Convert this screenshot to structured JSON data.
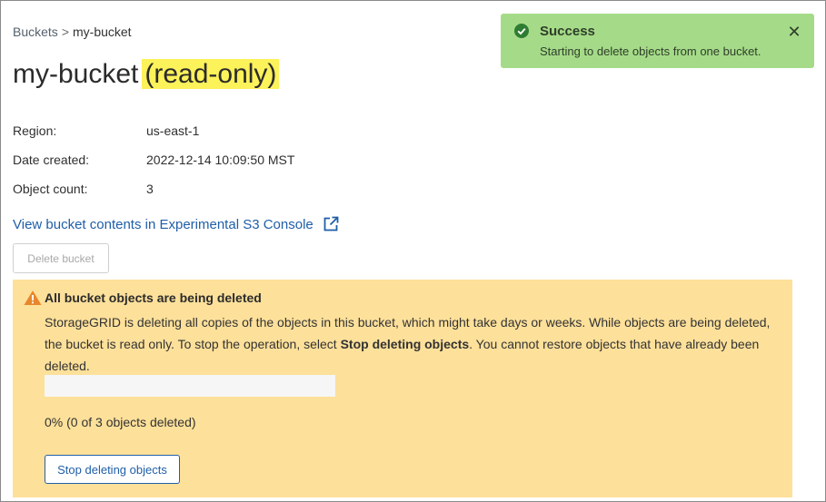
{
  "breadcrumb": {
    "parent": "Buckets",
    "separator": ">",
    "current": "my-bucket"
  },
  "title": {
    "name": "my-bucket",
    "badge": "(read-only)"
  },
  "properties": [
    {
      "label": "Region:",
      "value": "us-east-1"
    },
    {
      "label": "Date created:",
      "value": "2022-12-14 10:09:50 MST"
    },
    {
      "label": "Object count:",
      "value": "3"
    }
  ],
  "console_link": {
    "label": "View bucket contents in Experimental S3 Console",
    "icon": "external-link-icon"
  },
  "delete_button": {
    "label": "Delete bucket",
    "disabled": true
  },
  "warning": {
    "icon": "warning-icon",
    "title": "All bucket objects are being deleted",
    "body_before": "StorageGRID is deleting all copies of the objects in this bucket, which might take days or weeks. While objects are being deleted, the bucket is read only. To stop the operation, select ",
    "body_bold": "Stop deleting objects",
    "body_after": ". You cannot restore objects that have already been deleted.",
    "progress_fraction": 0,
    "progress_text": "0% (0 of 3 objects deleted)",
    "stop_button": "Stop deleting objects"
  },
  "toast": {
    "icon": "check-circle-icon",
    "title": "Success",
    "message": "Starting to delete objects from one bucket.",
    "close_icon": "close-icon"
  },
  "colors": {
    "link": "#1f5ea8",
    "highlight": "#fcf25a",
    "warning_bg": "#fde09a",
    "warning_icon": "#e8862b",
    "toast_bg": "#a5db88",
    "success_icon": "#2e7d32"
  }
}
